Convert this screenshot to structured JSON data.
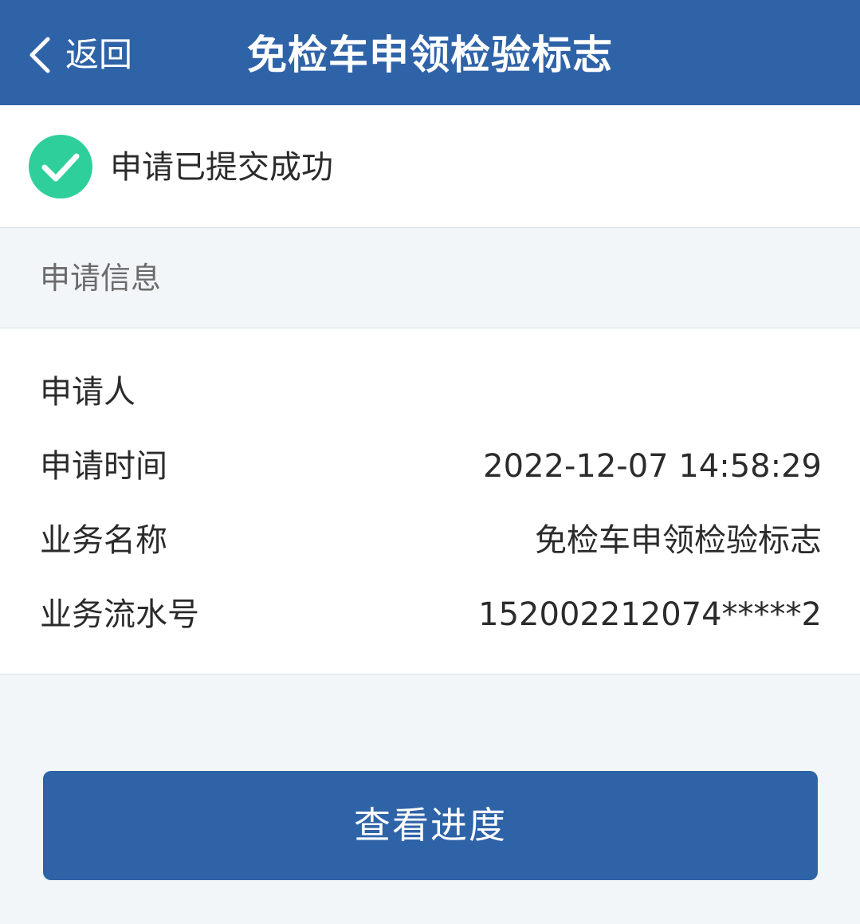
{
  "header": {
    "back_label": "返回",
    "title": "免检车申领检验标志",
    "background_color": "#2f63a8"
  },
  "status": {
    "icon": "check-circle-icon",
    "icon_color": "#2ecf9b",
    "message": "申请已提交成功"
  },
  "section": {
    "title": "申请信息"
  },
  "info": {
    "rows": [
      {
        "label": "申请人",
        "value": ""
      },
      {
        "label": "申请时间",
        "value": "2022-12-07 14:58:29"
      },
      {
        "label": "业务名称",
        "value": "免检车申领检验标志"
      },
      {
        "label": "业务流水号",
        "value": "152002212074*****2"
      }
    ]
  },
  "actions": {
    "view_progress_label": "查看进度"
  }
}
